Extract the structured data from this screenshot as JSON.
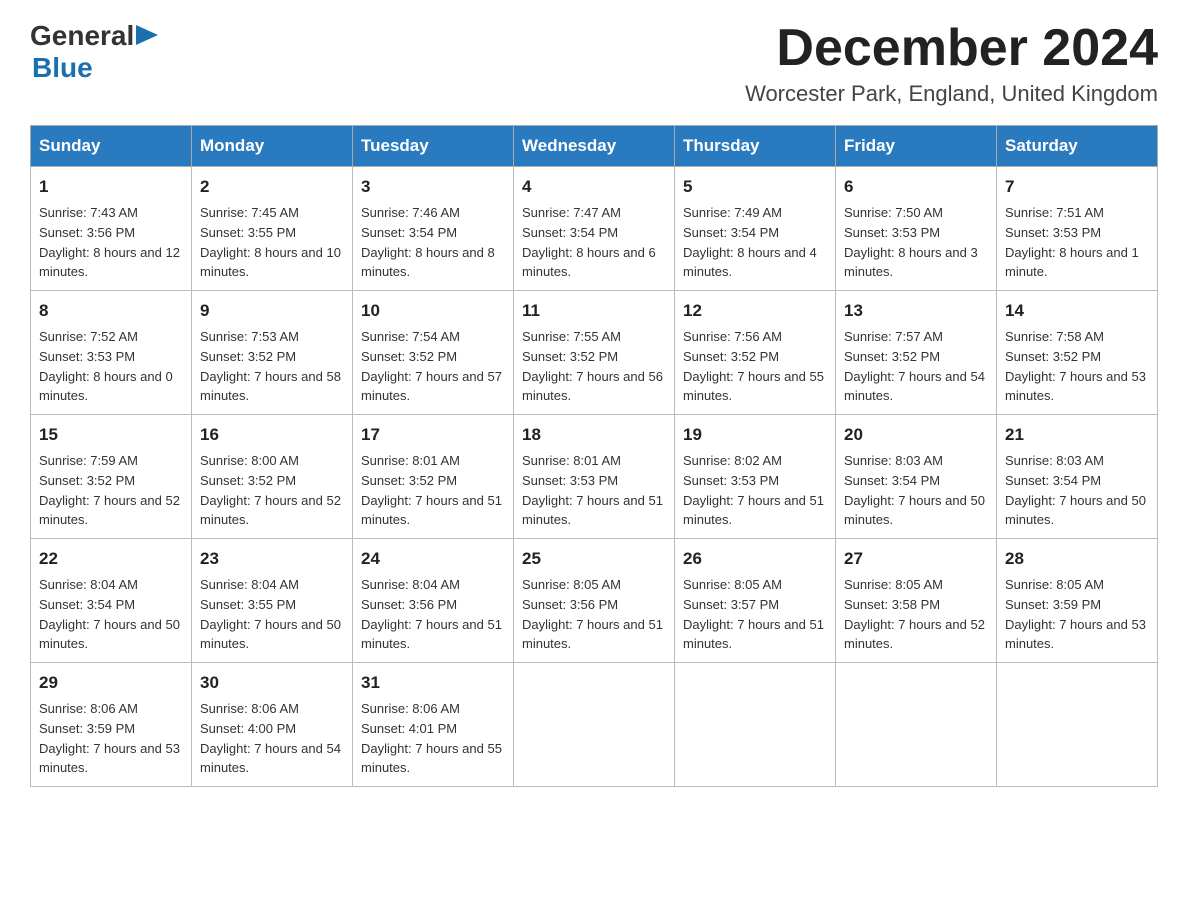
{
  "header": {
    "logo": {
      "general": "General",
      "blue": "Blue",
      "arrow_color": "#1a6faf"
    },
    "title": "December 2024",
    "location": "Worcester Park, England, United Kingdom"
  },
  "calendar": {
    "weekdays": [
      "Sunday",
      "Monday",
      "Tuesday",
      "Wednesday",
      "Thursday",
      "Friday",
      "Saturday"
    ],
    "weeks": [
      [
        {
          "day": "1",
          "sunrise": "Sunrise: 7:43 AM",
          "sunset": "Sunset: 3:56 PM",
          "daylight": "Daylight: 8 hours and 12 minutes."
        },
        {
          "day": "2",
          "sunrise": "Sunrise: 7:45 AM",
          "sunset": "Sunset: 3:55 PM",
          "daylight": "Daylight: 8 hours and 10 minutes."
        },
        {
          "day": "3",
          "sunrise": "Sunrise: 7:46 AM",
          "sunset": "Sunset: 3:54 PM",
          "daylight": "Daylight: 8 hours and 8 minutes."
        },
        {
          "day": "4",
          "sunrise": "Sunrise: 7:47 AM",
          "sunset": "Sunset: 3:54 PM",
          "daylight": "Daylight: 8 hours and 6 minutes."
        },
        {
          "day": "5",
          "sunrise": "Sunrise: 7:49 AM",
          "sunset": "Sunset: 3:54 PM",
          "daylight": "Daylight: 8 hours and 4 minutes."
        },
        {
          "day": "6",
          "sunrise": "Sunrise: 7:50 AM",
          "sunset": "Sunset: 3:53 PM",
          "daylight": "Daylight: 8 hours and 3 minutes."
        },
        {
          "day": "7",
          "sunrise": "Sunrise: 7:51 AM",
          "sunset": "Sunset: 3:53 PM",
          "daylight": "Daylight: 8 hours and 1 minute."
        }
      ],
      [
        {
          "day": "8",
          "sunrise": "Sunrise: 7:52 AM",
          "sunset": "Sunset: 3:53 PM",
          "daylight": "Daylight: 8 hours and 0 minutes."
        },
        {
          "day": "9",
          "sunrise": "Sunrise: 7:53 AM",
          "sunset": "Sunset: 3:52 PM",
          "daylight": "Daylight: 7 hours and 58 minutes."
        },
        {
          "day": "10",
          "sunrise": "Sunrise: 7:54 AM",
          "sunset": "Sunset: 3:52 PM",
          "daylight": "Daylight: 7 hours and 57 minutes."
        },
        {
          "day": "11",
          "sunrise": "Sunrise: 7:55 AM",
          "sunset": "Sunset: 3:52 PM",
          "daylight": "Daylight: 7 hours and 56 minutes."
        },
        {
          "day": "12",
          "sunrise": "Sunrise: 7:56 AM",
          "sunset": "Sunset: 3:52 PM",
          "daylight": "Daylight: 7 hours and 55 minutes."
        },
        {
          "day": "13",
          "sunrise": "Sunrise: 7:57 AM",
          "sunset": "Sunset: 3:52 PM",
          "daylight": "Daylight: 7 hours and 54 minutes."
        },
        {
          "day": "14",
          "sunrise": "Sunrise: 7:58 AM",
          "sunset": "Sunset: 3:52 PM",
          "daylight": "Daylight: 7 hours and 53 minutes."
        }
      ],
      [
        {
          "day": "15",
          "sunrise": "Sunrise: 7:59 AM",
          "sunset": "Sunset: 3:52 PM",
          "daylight": "Daylight: 7 hours and 52 minutes."
        },
        {
          "day": "16",
          "sunrise": "Sunrise: 8:00 AM",
          "sunset": "Sunset: 3:52 PM",
          "daylight": "Daylight: 7 hours and 52 minutes."
        },
        {
          "day": "17",
          "sunrise": "Sunrise: 8:01 AM",
          "sunset": "Sunset: 3:52 PM",
          "daylight": "Daylight: 7 hours and 51 minutes."
        },
        {
          "day": "18",
          "sunrise": "Sunrise: 8:01 AM",
          "sunset": "Sunset: 3:53 PM",
          "daylight": "Daylight: 7 hours and 51 minutes."
        },
        {
          "day": "19",
          "sunrise": "Sunrise: 8:02 AM",
          "sunset": "Sunset: 3:53 PM",
          "daylight": "Daylight: 7 hours and 51 minutes."
        },
        {
          "day": "20",
          "sunrise": "Sunrise: 8:03 AM",
          "sunset": "Sunset: 3:54 PM",
          "daylight": "Daylight: 7 hours and 50 minutes."
        },
        {
          "day": "21",
          "sunrise": "Sunrise: 8:03 AM",
          "sunset": "Sunset: 3:54 PM",
          "daylight": "Daylight: 7 hours and 50 minutes."
        }
      ],
      [
        {
          "day": "22",
          "sunrise": "Sunrise: 8:04 AM",
          "sunset": "Sunset: 3:54 PM",
          "daylight": "Daylight: 7 hours and 50 minutes."
        },
        {
          "day": "23",
          "sunrise": "Sunrise: 8:04 AM",
          "sunset": "Sunset: 3:55 PM",
          "daylight": "Daylight: 7 hours and 50 minutes."
        },
        {
          "day": "24",
          "sunrise": "Sunrise: 8:04 AM",
          "sunset": "Sunset: 3:56 PM",
          "daylight": "Daylight: 7 hours and 51 minutes."
        },
        {
          "day": "25",
          "sunrise": "Sunrise: 8:05 AM",
          "sunset": "Sunset: 3:56 PM",
          "daylight": "Daylight: 7 hours and 51 minutes."
        },
        {
          "day": "26",
          "sunrise": "Sunrise: 8:05 AM",
          "sunset": "Sunset: 3:57 PM",
          "daylight": "Daylight: 7 hours and 51 minutes."
        },
        {
          "day": "27",
          "sunrise": "Sunrise: 8:05 AM",
          "sunset": "Sunset: 3:58 PM",
          "daylight": "Daylight: 7 hours and 52 minutes."
        },
        {
          "day": "28",
          "sunrise": "Sunrise: 8:05 AM",
          "sunset": "Sunset: 3:59 PM",
          "daylight": "Daylight: 7 hours and 53 minutes."
        }
      ],
      [
        {
          "day": "29",
          "sunrise": "Sunrise: 8:06 AM",
          "sunset": "Sunset: 3:59 PM",
          "daylight": "Daylight: 7 hours and 53 minutes."
        },
        {
          "day": "30",
          "sunrise": "Sunrise: 8:06 AM",
          "sunset": "Sunset: 4:00 PM",
          "daylight": "Daylight: 7 hours and 54 minutes."
        },
        {
          "day": "31",
          "sunrise": "Sunrise: 8:06 AM",
          "sunset": "Sunset: 4:01 PM",
          "daylight": "Daylight: 7 hours and 55 minutes."
        },
        null,
        null,
        null,
        null
      ]
    ]
  }
}
